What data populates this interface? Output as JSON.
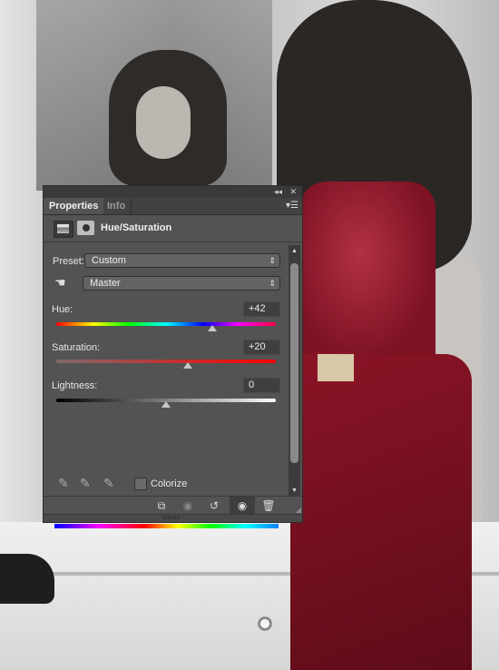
{
  "panel": {
    "tabs": [
      {
        "label": "Properties",
        "active": true
      },
      {
        "label": "Info",
        "active": false
      }
    ],
    "title_buttons": {
      "collapse": "◂◂",
      "close": "✕"
    },
    "menu_icon": "panel-menu-icon",
    "header_title": "Hue/Saturation",
    "preset": {
      "label": "Preset:",
      "value": "Custom"
    },
    "channel": {
      "value": "Master"
    },
    "hue": {
      "label": "Hue:",
      "value": "+42",
      "slider_fraction": 0.6167
    },
    "saturation": {
      "label": "Saturation:",
      "value": "+20",
      "slider_fraction": 0.6
    },
    "lightness": {
      "label": "Lightness:",
      "value": "0",
      "slider_fraction": 0.5
    },
    "colorize": {
      "label": "Colorize",
      "checked": false
    },
    "footer_buttons": [
      {
        "name": "clip-to-layer",
        "glyph": "⬚"
      },
      {
        "name": "view-previous-state",
        "glyph": "👁"
      },
      {
        "name": "reset",
        "glyph": "↺"
      },
      {
        "name": "toggle-visibility",
        "glyph": "👁"
      },
      {
        "name": "delete",
        "glyph": "🗑"
      }
    ]
  }
}
